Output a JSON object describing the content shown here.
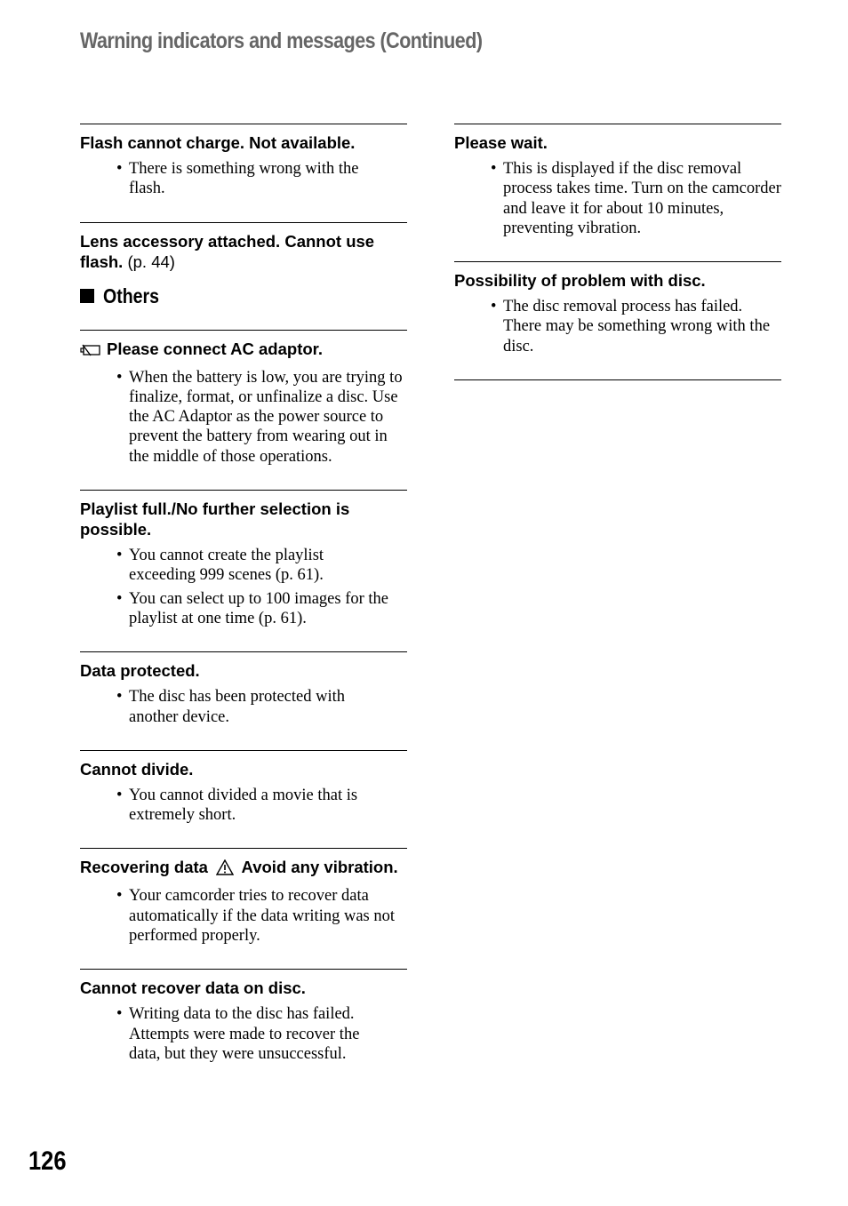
{
  "header": {
    "title": "Warning indicators and messages (Continued)"
  },
  "left_column": {
    "entries_before_section": [
      {
        "title": "Flash cannot charge. Not available.",
        "ref": "",
        "bullets": [
          "There is something wrong with the flash."
        ]
      },
      {
        "title": "Lens accessory attached. Cannot use flash.",
        "ref": "(p. 44)",
        "bullets": []
      }
    ],
    "section": {
      "icon": "black-square",
      "title": "Others"
    },
    "entries": [
      {
        "icon": "ac-adaptor-battery-icon",
        "title": "Please connect AC adaptor.",
        "bullets": [
          "When the battery is low, you are trying to finalize, format, or unfinalize a disc. Use the AC Adaptor as the power source to prevent the battery from wearing out in the middle of those operations."
        ]
      },
      {
        "title": "Playlist full./No further selection is possible.",
        "bullets": [
          "You cannot create the playlist exceeding 999 scenes (p. 61).",
          "You can select up to 100 images for the playlist at one time (p. 61)."
        ]
      },
      {
        "title": "Data protected.",
        "bullets": [
          "The disc has been protected with another device."
        ]
      },
      {
        "title": "Cannot divide.",
        "bullets": [
          "You cannot divided a movie that is extremely short."
        ]
      },
      {
        "title_part1": "Recovering data",
        "icon": "warning-triangle-icon",
        "title_part2": "Avoid any vibration.",
        "bullets": [
          "Your camcorder tries to recover data automatically if the data writing was not performed properly."
        ]
      },
      {
        "title": "Cannot recover data on disc.",
        "bullets": [
          "Writing data to the disc has failed. Attempts were made to recover the data, but they were unsuccessful."
        ]
      }
    ]
  },
  "right_column": {
    "entries": [
      {
        "title": "Please wait.",
        "bullets": [
          "This is displayed if the disc removal process takes time. Turn on the camcorder and leave it for about 10 minutes, preventing vibration."
        ]
      },
      {
        "title": "Possibility of problem with disc.",
        "bullets": [
          "The disc removal process has failed. There may be something wrong with the disc."
        ]
      }
    ]
  },
  "footer": {
    "page_number": "126"
  }
}
